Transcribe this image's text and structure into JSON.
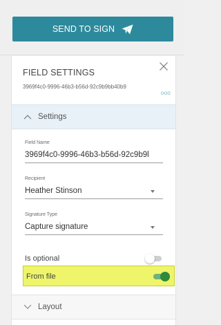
{
  "send_button": {
    "label": "SEND TO SIGN",
    "icon": "paper-plane-icon",
    "color": "#2d8a9c"
  },
  "panel": {
    "title": "FIELD SETTINGS",
    "field_id": "3969f4c0-9996-46b3-b56d-92c9b9bb40b9",
    "more_indicator": "ooo",
    "close_icon": "close-icon"
  },
  "settings_section": {
    "label": "Settings",
    "expanded": true,
    "icon": "chevron-up-icon",
    "field_name": {
      "label": "Field Name",
      "value": "3969f4c0-9996-46b3-b56d-92c9b9l"
    },
    "recipient": {
      "label": "Recipient",
      "value": "Heather Stinson"
    },
    "signature_type": {
      "label": "Signature Type",
      "value": "Capture signature"
    },
    "is_optional": {
      "label": "Is optional",
      "on": false
    },
    "from_file": {
      "label": "From file",
      "on": true,
      "highlight_color": "#eef56a"
    }
  },
  "layout_section": {
    "label": "Layout",
    "expanded": false,
    "icon": "chevron-down-icon"
  }
}
